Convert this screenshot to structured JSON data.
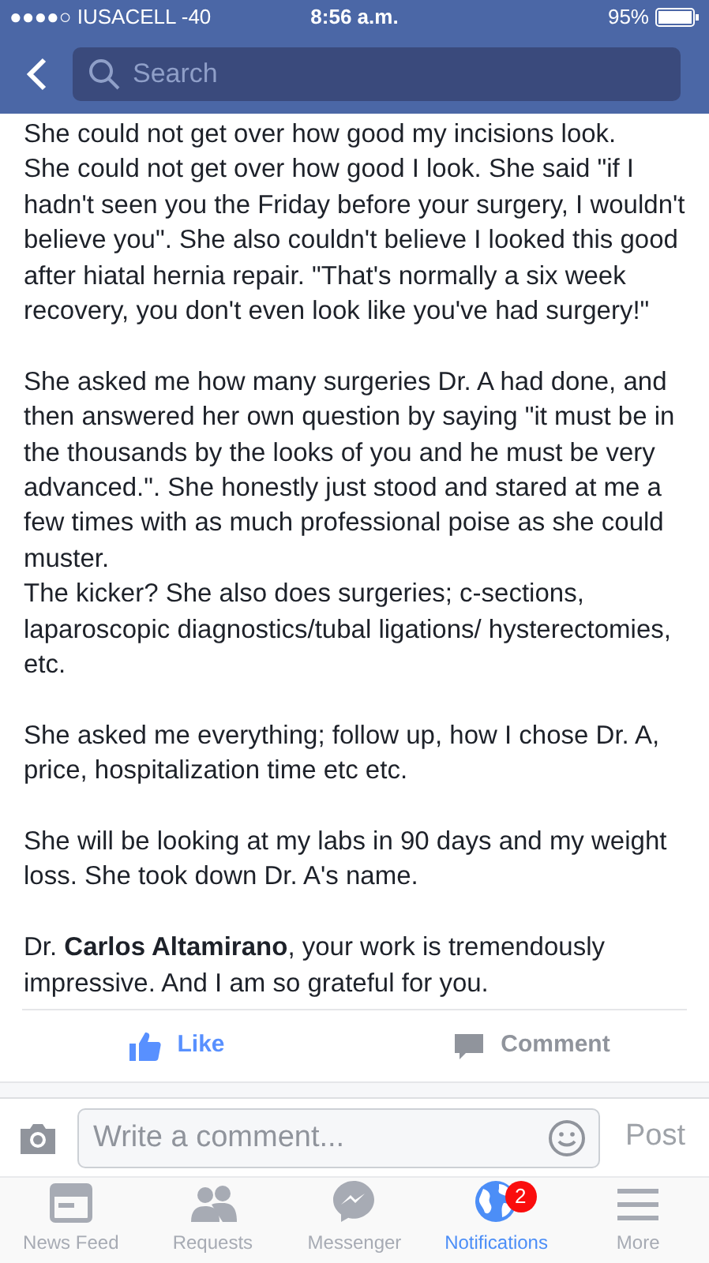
{
  "status_bar": {
    "carrier": "●●●●○ IUSACELL  -40",
    "time": "8:56 a.m.",
    "battery": "95%"
  },
  "header": {
    "search": {
      "placeholder": "Search"
    }
  },
  "post": {
    "paragraphs": [
      {
        "lines": [
          "She could not get over how good my incisions look.",
          "She could not get over how good I look. She said \"if I hadn't seen you the Friday before your surgery, I wouldn't believe you\". She also couldn't believe I looked this good after hiatal hernia repair. \"That's normally a six week recovery, you don't even look like you've had surgery!\""
        ]
      },
      {
        "lines": [
          "She asked me how many surgeries Dr. A had done, and then answered her own question by saying \"it must be in the thousands by the looks of you and he must be very advanced.\". She honestly just stood and stared at me a few times with as much professional poise as she could muster.",
          "The kicker? She also does surgeries; c-sections, laparoscopic diagnostics/tubal ligations/ hysterectomies, etc."
        ]
      },
      {
        "lines": [
          "She asked me everything; follow up, how I chose Dr. A, price, hospitalization time etc etc."
        ]
      },
      {
        "lines": [
          "She will be looking at my labs in 90 days and my weight loss. She took down Dr. A's name."
        ]
      },
      {
        "lines": [
          "Dr. **Carlos Altamirano**, your work is tremendously impressive. And I am so grateful for you."
        ]
      }
    ]
  },
  "actions": [
    {
      "kind": "like",
      "label": "Like",
      "selected": true
    },
    {
      "kind": "comment",
      "label": "Comment",
      "selected": false
    }
  ],
  "comment_bar": {
    "placeholder": "Write a comment...",
    "post": "Post"
  },
  "tabs": [
    {
      "kind": "feed",
      "label": "News Feed",
      "selected": false
    },
    {
      "kind": "requests",
      "label": "Requests",
      "selected": false
    },
    {
      "kind": "messenger",
      "label": "Messenger",
      "selected": false
    },
    {
      "kind": "notifications",
      "label": "Notifications",
      "selected": true,
      "badge": "2"
    },
    {
      "kind": "more",
      "label": "More",
      "selected": false
    }
  ]
}
